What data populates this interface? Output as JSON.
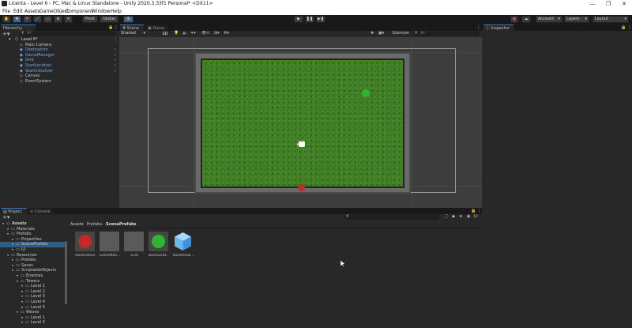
{
  "window": {
    "title": "Licenta - Level 6 - PC, Mac & Linux Standalone - Unity 2020.3.33f1 Personal* <DX11>",
    "minimize": "—",
    "maximize": "❐",
    "close": "✕"
  },
  "menu": [
    "File",
    "Edit",
    "Assets",
    "GameObject",
    "Component",
    "Window",
    "Help"
  ],
  "toolbar": {
    "pivot_label": "Pivot",
    "global_label": "Global",
    "account_label": "Account",
    "layers_label": "Layers",
    "layout_label": "Layout"
  },
  "hierarchy": {
    "tab_label": "Hierarchy",
    "search_label": "All",
    "scene_name": "Level 6*",
    "items": [
      {
        "label": "Main Camera",
        "prefab": false
      },
      {
        "label": "Destination",
        "prefab": true
      },
      {
        "label": "GameManager",
        "prefab": true
      },
      {
        "label": "Grid",
        "prefab": true
      },
      {
        "label": "StartLocation",
        "prefab": true
      },
      {
        "label": "StartInitializer",
        "prefab": true
      },
      {
        "label": "Canvas",
        "prefab": false
      },
      {
        "label": "EventSystem",
        "prefab": false
      }
    ]
  },
  "scene_view": {
    "tabs": [
      "Scene",
      "Game"
    ],
    "shading_mode": "Shaded",
    "mode_2d": "2D",
    "gizmos_label": "Gizmos",
    "search_label": "All",
    "layers_count": "0"
  },
  "inspector": {
    "tab_label": "Inspector"
  },
  "project": {
    "tabs": [
      "Project",
      "Console"
    ],
    "breadcrumb": [
      "Assets",
      "Prefabs",
      "ScenePrefabs"
    ],
    "hidden_count": "10",
    "tree": [
      {
        "label": "Assets",
        "level": 0,
        "bold": true
      },
      {
        "label": "Materials",
        "level": 1
      },
      {
        "label": "Prefabs",
        "level": 1
      },
      {
        "label": "Projectiles",
        "level": 2
      },
      {
        "label": "ScenePrefabs",
        "level": 2,
        "selected": true
      },
      {
        "label": "UI",
        "level": 2
      },
      {
        "label": "Resources",
        "level": 1
      },
      {
        "label": "Prefabs",
        "level": 2
      },
      {
        "label": "Saves",
        "level": 2
      },
      {
        "label": "ScriptableObjects",
        "level": 2
      },
      {
        "label": "Enemies",
        "level": 3
      },
      {
        "label": "Towers",
        "level": 3
      },
      {
        "label": "Level 1",
        "level": 4
      },
      {
        "label": "Level 2",
        "level": 4
      },
      {
        "label": "Level 3",
        "level": 4
      },
      {
        "label": "Level 4",
        "level": 4
      },
      {
        "label": "Level 5",
        "level": 4
      },
      {
        "label": "Waves",
        "level": 3
      },
      {
        "label": "Level 1",
        "level": 4
      },
      {
        "label": "Level 2",
        "level": 4
      }
    ],
    "assets": [
      {
        "label": "Destination",
        "kind": "red-circle"
      },
      {
        "label": "GameMan...",
        "kind": "gray-square"
      },
      {
        "label": "Grid",
        "kind": "gray-square"
      },
      {
        "label": "StartLocat...",
        "kind": "green-circle"
      },
      {
        "label": "StartInitial...",
        "kind": "cube"
      }
    ]
  },
  "colors": {
    "accent": "#3a79bb",
    "grass": "#3f7d24",
    "destination": "#c32929",
    "start": "#2fb52f",
    "prefab_text": "#6fa8e6"
  }
}
